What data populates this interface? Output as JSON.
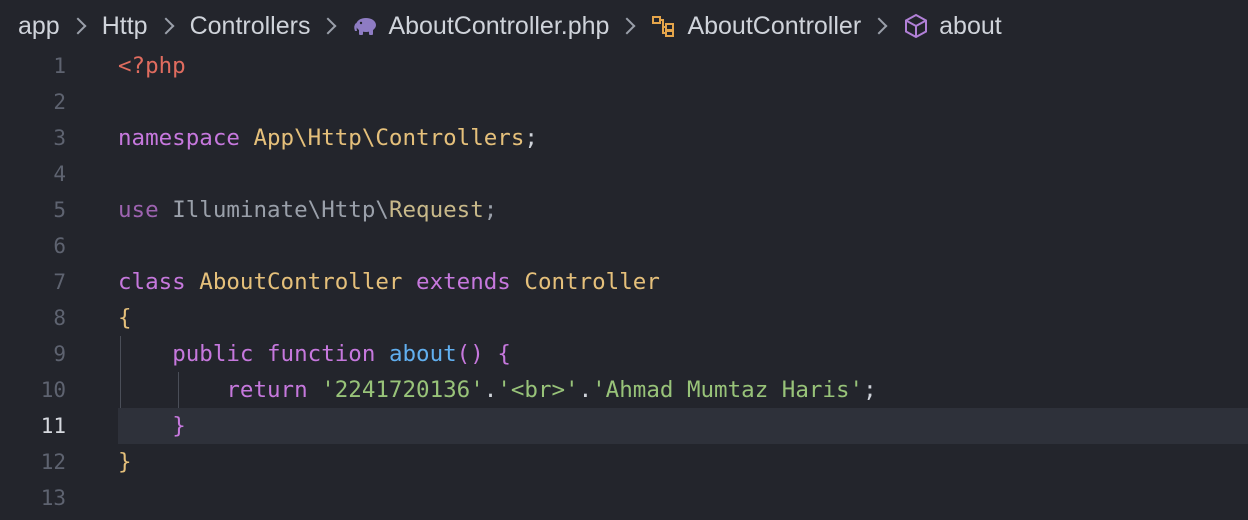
{
  "breadcrumb": {
    "items": [
      {
        "label": "app"
      },
      {
        "label": "Http"
      },
      {
        "label": "Controllers"
      },
      {
        "label": "AboutController.php",
        "icon": "php-elephant-icon"
      },
      {
        "label": "AboutController",
        "icon": "class-icon"
      },
      {
        "label": "about",
        "icon": "method-cube-icon"
      }
    ]
  },
  "editor": {
    "active_line": 11,
    "line_numbers": [
      "1",
      "2",
      "3",
      "4",
      "5",
      "6",
      "7",
      "8",
      "9",
      "10",
      "11",
      "12",
      "13"
    ],
    "code": {
      "l1": {
        "open_tag": "<?php"
      },
      "l3": {
        "kw": "namespace",
        "sp": " ",
        "ns": "App\\Http\\Controllers",
        "semi": ";"
      },
      "l5": {
        "kw": "use",
        "sp": " ",
        "ns1": "Illuminate",
        "bs1": "\\",
        "ns2": "Http",
        "bs2": "\\",
        "cls": "Request",
        "semi": ";"
      },
      "l7": {
        "kw1": "class",
        "sp1": " ",
        "name": "AboutController",
        "sp2": " ",
        "kw2": "extends",
        "sp3": " ",
        "parent": "Controller"
      },
      "l8": {
        "brace": "{"
      },
      "l9": {
        "indent": "    ",
        "kw1": "public",
        "sp1": " ",
        "kw2": "function",
        "sp2": " ",
        "fn": "about",
        "parens": "()",
        "sp3": " ",
        "brace": "{"
      },
      "l10": {
        "indent": "        ",
        "kw": "return",
        "sp": " ",
        "s1": "'2241720136'",
        "dot1": ".",
        "s2": "'<br>'",
        "dot2": ".",
        "s3": "'Ahmad Mumtaz Haris'",
        "semi": ";"
      },
      "l11": {
        "indent": "    ",
        "brace": "}"
      },
      "l12": {
        "brace": "}"
      }
    }
  },
  "colors": {
    "background": "#23252c",
    "active_line": "#2e313a",
    "keyword": "#c678dd",
    "class": "#e5c07b",
    "string": "#98c379",
    "function": "#61afef",
    "php_tag": "#e06c5f"
  }
}
